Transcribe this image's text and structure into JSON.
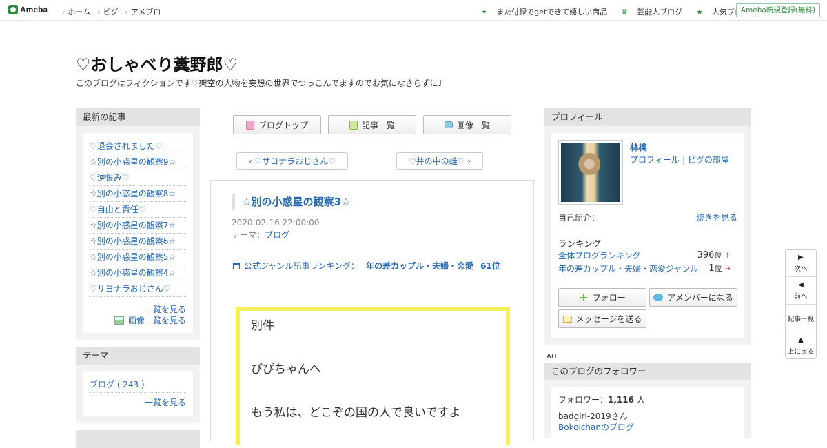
{
  "topbar": {
    "logo_text": "Ameba",
    "nav": [
      "ホーム",
      "ピグ",
      "アメブロ"
    ],
    "right_links": [
      {
        "icon": "sparkle-icon",
        "label": "また付録でgetできて嬉しい商品"
      },
      {
        "icon": "crown-icon",
        "label": "芸能人ブログ"
      },
      {
        "icon": "star-icon",
        "label": "人気ブログ"
      }
    ],
    "signup": "Ameba新規登録(無料)"
  },
  "header": {
    "title": "♡おしゃべり糞野郎♡",
    "description": "このブログはフィクションです♡架空の人物を妄想の世界でつっこんでますのでお気になさらずに♪"
  },
  "left": {
    "recent_heading": "最新の記事",
    "recent_items": [
      "♡退会されました♡",
      "☆別の小惑星の観察9☆",
      "♡逆恨み♡",
      "☆別の小惑星の観察8☆",
      "♡自由と責任♡",
      "☆別の小惑星の観察7☆",
      "☆別の小惑星の観察6☆",
      "☆別の小惑星の観察5☆",
      "☆別の小惑星の観察4☆",
      "♡サヨナラおじさん♡"
    ],
    "see_list": "一覧を見る",
    "see_images": "画像一覧を見る",
    "theme_heading": "テーマ",
    "theme_item": "ブログ ( 243 )",
    "theme_see_list": "一覧を見る"
  },
  "center": {
    "nav_buttons": [
      "ブログトップ",
      "記事一覧",
      "画像一覧"
    ],
    "prev_article": "♡サヨナラおじさん♡",
    "next_article": "♡井の中の蛙♡",
    "article": {
      "title": "☆別の小惑星の観察3☆",
      "date": "2020-02-16 22:00:00",
      "theme_label": "テーマ：",
      "theme_value": "ブログ",
      "ranking_label": "公式ジャンル記事ランキング：",
      "ranking_genre": "年の差カップル・夫婦・恋愛",
      "ranking_rank": "61位",
      "body_lines": [
        "別件",
        "",
        "ぴぴちゃんへ",
        "",
        "もう私は、どこぞの国の人で良いですよ"
      ]
    }
  },
  "right": {
    "profile_heading": "プロフィール",
    "name": "林檎",
    "profile_link": "プロフィール",
    "pig_link": "ピグの部屋",
    "intro_label": "自己紹介：",
    "intro_more": "続きを見る",
    "ranking_label": "ランキング",
    "rankings": [
      {
        "label": "全体ブログランキング",
        "value": "396",
        "unit": "位",
        "trend": "↑"
      },
      {
        "label": "年の差カップル・夫婦・恋愛ジャンル",
        "value": "1",
        "unit": "位",
        "trend": "→"
      }
    ],
    "follow_btn": "フォロー",
    "member_btn": "アメンバーになる",
    "message_btn": "メッセージを送る",
    "ad_label": "AD",
    "followers_heading": "このブログのフォロワー",
    "followers_label": "フォロワー：",
    "followers_count": "1,116",
    "followers_unit": "人",
    "follower_name": "badgirl-2019さん",
    "follower_blog": "Bokoichanのブログ"
  },
  "floatnav": [
    "次へ",
    "前へ",
    "記事一覧",
    "上に戻る"
  ],
  "colors": {
    "link": "#2469b3",
    "accent": "#2d8c3c",
    "quote_border": "#f7ee5c"
  }
}
